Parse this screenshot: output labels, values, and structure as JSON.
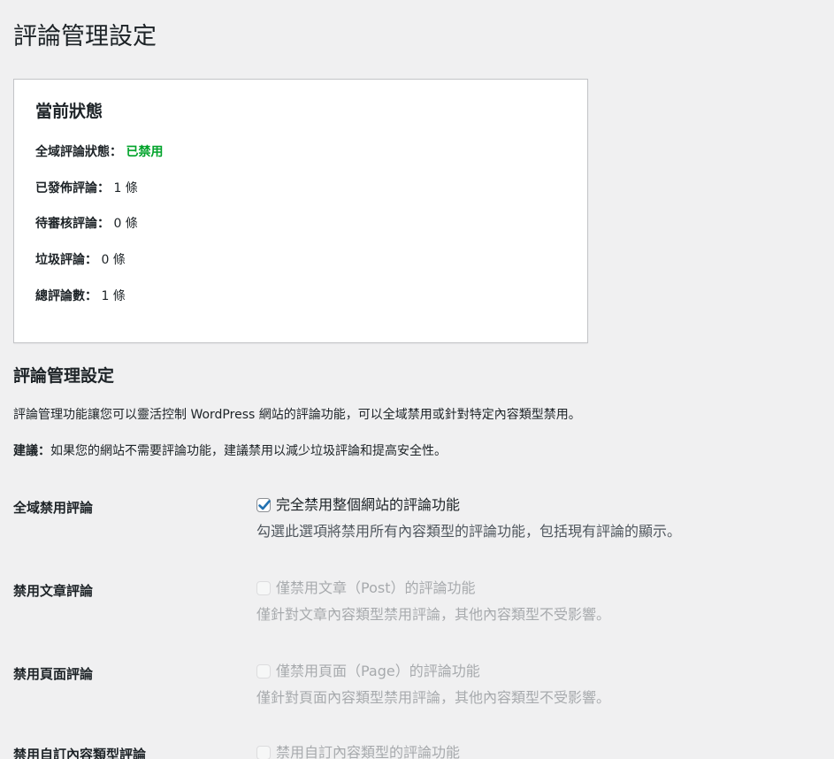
{
  "page": {
    "title": "評論管理設定"
  },
  "status": {
    "heading": "當前狀態",
    "global_label": "全域評論狀態：",
    "global_value": "已禁用",
    "published_label": "已發佈評論：",
    "published_value": "1 條",
    "pending_label": "待審核評論：",
    "pending_value": "0 條",
    "spam_label": "垃圾評論：",
    "spam_value": "0 條",
    "total_label": "總評論數：",
    "total_value": "1 條"
  },
  "settings": {
    "heading": "評論管理設定",
    "description": "評論管理功能讓您可以靈活控制 WordPress 網站的評論功能，可以全域禁用或針對特定內容類型禁用。",
    "tip_label": "建議：",
    "tip_text": "如果您的網站不需要評論功能，建議禁用以減少垃圾評論和提高安全性。",
    "rows": [
      {
        "label": "全域禁用評論",
        "checkbox_label": "完全禁用整個網站的評論功能",
        "help": "勾選此選項將禁用所有內容類型的評論功能，包括現有評論的顯示。",
        "checked": true,
        "disabled": false
      },
      {
        "label": "禁用文章評論",
        "checkbox_label": "僅禁用文章（Post）的評論功能",
        "help": "僅針對文章內容類型禁用評論，其他內容類型不受影響。",
        "checked": false,
        "disabled": true
      },
      {
        "label": "禁用頁面評論",
        "checkbox_label": "僅禁用頁面（Page）的評論功能",
        "help": "僅針對頁面內容類型禁用評論，其他內容類型不受影響。",
        "checked": false,
        "disabled": true
      },
      {
        "label": "禁用自訂內容類型評論",
        "checkbox_label": "禁用自訂內容類型的評論功能",
        "checked": false,
        "disabled": true
      }
    ]
  },
  "colors": {
    "enabled_status": "#00a32a",
    "checkmark": "#2271b1"
  },
  "icons": {
    "checkmark": "checkmark-icon"
  }
}
